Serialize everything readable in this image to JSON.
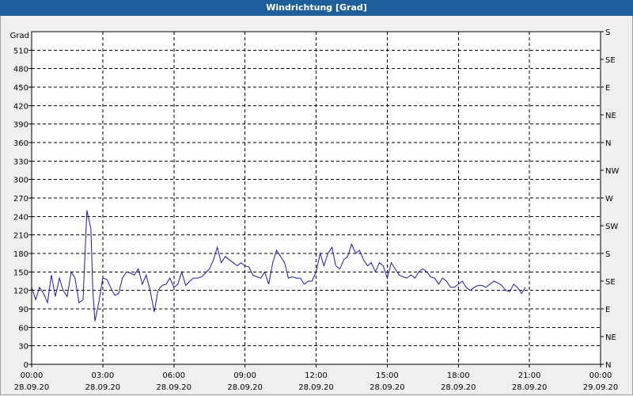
{
  "window": {
    "title": "Windrichtung [Grad]"
  },
  "colors": {
    "titlebar": "#1f5f9b",
    "line": "#1a1aa8",
    "plot_bg": "#ffffff",
    "grid": "#000000"
  },
  "chart_data": {
    "type": "line",
    "title": "Windrichtung [Grad]",
    "ylabel": "Grad",
    "xlabel": "",
    "ylim": [
      0,
      540
    ],
    "yticks": [
      0,
      30,
      60,
      90,
      120,
      150,
      180,
      210,
      240,
      270,
      300,
      330,
      360,
      390,
      420,
      450,
      480,
      510
    ],
    "y2_ticks": [
      {
        "deg": 0,
        "label": "N"
      },
      {
        "deg": 45,
        "label": "NE"
      },
      {
        "deg": 90,
        "label": "E"
      },
      {
        "deg": 135,
        "label": "SE"
      },
      {
        "deg": 180,
        "label": "S"
      },
      {
        "deg": 225,
        "label": "SW"
      },
      {
        "deg": 270,
        "label": "W"
      },
      {
        "deg": 315,
        "label": "NW"
      },
      {
        "deg": 360,
        "label": "N"
      },
      {
        "deg": 405,
        "label": "NE"
      },
      {
        "deg": 450,
        "label": "E"
      },
      {
        "deg": 495,
        "label": "SE"
      },
      {
        "deg": 540,
        "label": "S"
      }
    ],
    "xlim_hours": [
      0,
      24
    ],
    "xticks": [
      {
        "hour": 0,
        "time": "00:00",
        "date": "28.09.20"
      },
      {
        "hour": 3,
        "time": "03:00",
        "date": "28.09.20"
      },
      {
        "hour": 6,
        "time": "06:00",
        "date": "28.09.20"
      },
      {
        "hour": 9,
        "time": "09:00",
        "date": "28.09.20"
      },
      {
        "hour": 12,
        "time": "12:00",
        "date": "28.09.20"
      },
      {
        "hour": 15,
        "time": "15:00",
        "date": "28.09.20"
      },
      {
        "hour": 18,
        "time": "18:00",
        "date": "28.09.20"
      },
      {
        "hour": 21,
        "time": "21:00",
        "date": "28.09.20"
      },
      {
        "hour": 24,
        "time": "00:00",
        "date": "29.09.20"
      }
    ],
    "grid": true,
    "series": [
      {
        "x_hours": [
          0.0,
          0.17,
          0.33,
          0.5,
          0.67,
          0.83,
          1.0,
          1.17,
          1.33,
          1.5,
          1.67,
          1.83,
          2.0,
          2.17,
          2.33,
          2.5,
          2.58,
          2.67,
          2.83,
          3.0,
          3.17,
          3.33,
          3.5,
          3.67,
          3.83,
          4.0,
          4.17,
          4.33,
          4.5,
          4.67,
          4.83,
          5.0,
          5.17,
          5.33,
          5.5,
          5.67,
          5.83,
          6.0,
          6.17,
          6.33,
          6.5,
          6.67,
          6.83,
          7.0,
          7.17,
          7.33,
          7.5,
          7.67,
          7.83,
          8.0,
          8.17,
          8.33,
          8.5,
          8.67,
          8.83,
          9.0,
          9.17,
          9.33,
          9.5,
          9.67,
          9.83,
          10.0,
          10.17,
          10.33,
          10.5,
          10.67,
          10.83,
          11.0,
          11.17,
          11.33,
          11.5,
          11.67,
          11.83,
          12.0,
          12.17,
          12.33,
          12.5,
          12.67,
          12.83,
          13.0,
          13.17,
          13.33,
          13.5,
          13.67,
          13.83,
          14.0,
          14.17,
          14.33,
          14.5,
          14.67,
          14.83,
          15.0,
          15.17,
          15.33,
          15.5,
          15.67,
          15.83,
          16.0,
          16.17,
          16.33,
          16.5,
          16.67,
          16.83,
          17.0,
          17.17,
          17.33,
          17.5,
          17.67,
          17.83,
          18.0,
          18.17,
          18.33,
          18.5,
          18.67,
          18.83,
          19.0,
          19.17,
          19.33,
          19.5,
          19.67,
          19.83,
          20.0,
          20.17,
          20.33,
          20.5,
          20.67,
          20.83,
          21.0,
          21.17,
          21.33,
          21.5,
          21.67,
          21.83,
          22.0,
          22.17,
          22.33,
          22.5,
          22.67,
          22.83,
          23.0,
          23.17,
          23.33,
          23.5,
          23.67,
          23.83,
          24.0
        ],
        "values": [
          125,
          105,
          125,
          115,
          100,
          145,
          110,
          140,
          120,
          110,
          150,
          140,
          100,
          105,
          250,
          220,
          120,
          70,
          100,
          140,
          138,
          125,
          112,
          115,
          140,
          150,
          148,
          145,
          155,
          130,
          145,
          120,
          85,
          120,
          128,
          130,
          140,
          125,
          130,
          150,
          128,
          135,
          140,
          140,
          142,
          148,
          155,
          170,
          190,
          165,
          175,
          170,
          165,
          160,
          165,
          160,
          158,
          145,
          142,
          140,
          150,
          130,
          165,
          185,
          175,
          165,
          140,
          142,
          140,
          140,
          130,
          135,
          135,
          150,
          180,
          160,
          180,
          190,
          160,
          155,
          170,
          175,
          195,
          180,
          185,
          170,
          160,
          165,
          150,
          165,
          160,
          140,
          165,
          155,
          145,
          142,
          140,
          145,
          140,
          150,
          155,
          150,
          142,
          140,
          130,
          140,
          135,
          125,
          125,
          130,
          135,
          125,
          120,
          125,
          128,
          128,
          125,
          130,
          135,
          132,
          128,
          120,
          118,
          130,
          125,
          115,
          125
        ]
      }
    ]
  }
}
